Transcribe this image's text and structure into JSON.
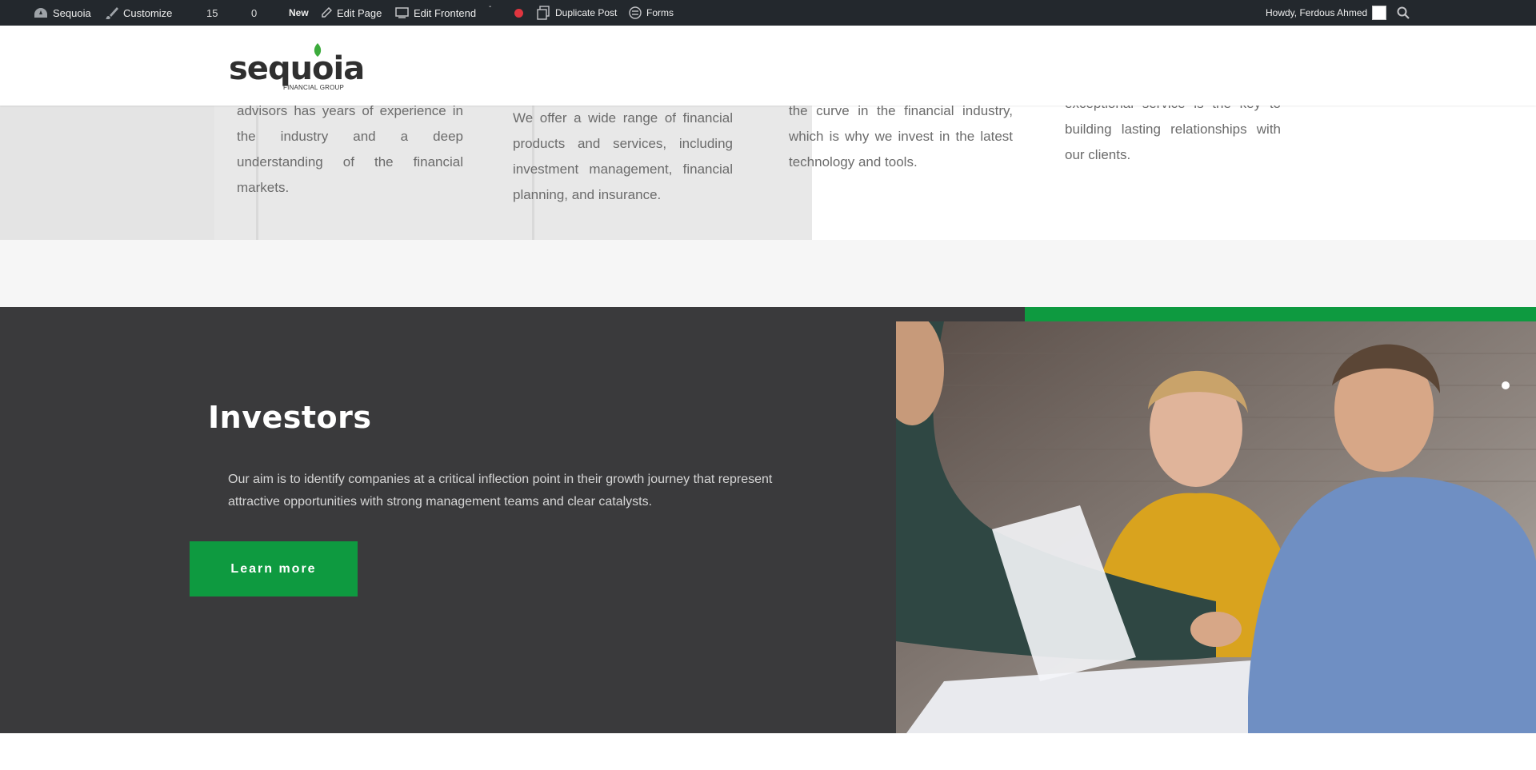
{
  "adminbar": {
    "site_name": "Sequoia",
    "customize": "Customize",
    "updates_count": "15",
    "comments_count": "0",
    "new_label": "New",
    "edit_page": "Edit Page",
    "edit_frontend": "Edit Frontend",
    "dash_mark": "-",
    "duplicate_post": "Duplicate Post",
    "forms": "Forms",
    "howdy": "Howdy, Ferdous Ahmed",
    "icons": [
      "dashboard-icon",
      "brush-icon",
      "pencil-icon",
      "frontend-icon",
      "status-dot-icon",
      "duplicate-icon",
      "forms-icon",
      "search-icon"
    ]
  },
  "logo": {
    "word": "sequoia",
    "sub": "FINANCIAL GROUP",
    "leaf_color": "#3cab3c"
  },
  "features": [
    {
      "text": "advisors has years of experience in the industry and a deep understanding of the financial markets."
    },
    {
      "text": "We offer a wide range of financial products and services, including investment management, financial planning, and insurance."
    },
    {
      "text": "the curve in the financial industry, which is why we invest in the latest technology and tools."
    },
    {
      "text": "exceptional service is the key to building lasting relationships with our clients."
    }
  ],
  "investors": {
    "title": "Investors",
    "description": "Our aim is to identify companies at a critical inflection point in their growth journey that represent attractive opportunities with strong management teams and clear catalysts.",
    "button": "Learn more"
  },
  "colors": {
    "accent_green": "#0e9a40",
    "dark_section": "#3a3a3c",
    "adminbar": "#23282d"
  }
}
